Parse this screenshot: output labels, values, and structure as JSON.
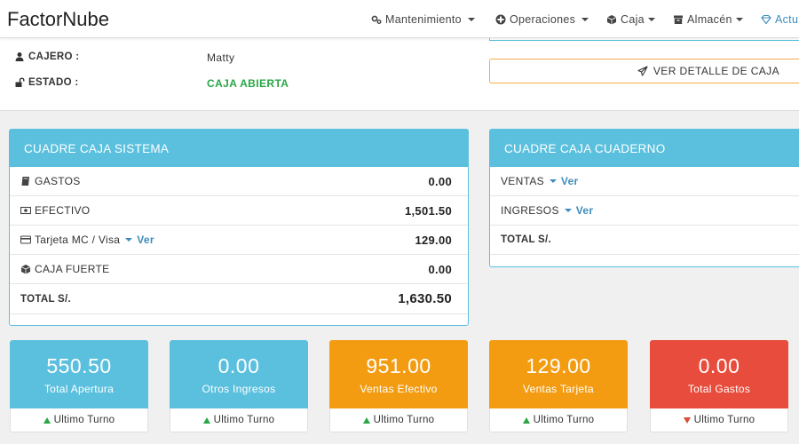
{
  "navbar": {
    "brand": "FactorNube",
    "items": [
      {
        "label": "Mantenimiento",
        "icon": "cogs-icon"
      },
      {
        "label": "Operaciones",
        "icon": "plus-circle-icon"
      },
      {
        "label": "Caja",
        "icon": "cube-icon"
      },
      {
        "label": "Almacén",
        "icon": "archive-icon"
      },
      {
        "label": "Actu",
        "icon": "diamond-icon"
      }
    ]
  },
  "info": {
    "cajero_label": "CAJERO :",
    "cajero_value": "Matty",
    "estado_label": "ESTADO :",
    "estado_value": "CAJA ABIERTA",
    "ver_detalle": "VER DETALLE DE CAJA"
  },
  "sistema": {
    "title": "CUADRE CAJA SISTEMA",
    "rows": [
      {
        "label": "GASTOS",
        "value": "0.00",
        "icon": "book-icon"
      },
      {
        "label": "EFECTIVO",
        "value": "1,501.50",
        "icon": "money-icon"
      },
      {
        "label": "Tarjeta MC / Visa",
        "link": "Ver",
        "value": "129.00",
        "icon": "credit-card-icon"
      },
      {
        "label": "CAJA FUERTE",
        "value": "0.00",
        "icon": "cube-icon"
      }
    ],
    "total_label": "TOTAL S/.",
    "total_value": "1,630.50"
  },
  "cuaderno": {
    "title": "CUADRE CAJA CUADERNO",
    "rows": [
      {
        "label": "VENTAS",
        "link": "Ver"
      },
      {
        "label": "INGRESOS",
        "link": "Ver"
      }
    ],
    "total_label": "TOTAL S/."
  },
  "stats": [
    {
      "value": "550.50",
      "label": "Total Apertura",
      "foot": "Ultimo Turno",
      "color": "#5bc0de",
      "trend": "up"
    },
    {
      "value": "0.00",
      "label": "Otros Ingresos",
      "foot": "Ultimo Turno",
      "color": "#5bc0de",
      "trend": "up"
    },
    {
      "value": "951.00",
      "label": "Ventas Efectivo",
      "foot": "Ultimo Turno",
      "color": "#f39c12",
      "trend": "up"
    },
    {
      "value": "129.00",
      "label": "Ventas Tarjeta",
      "foot": "Ultimo Turno",
      "color": "#f39c12",
      "trend": "up"
    },
    {
      "value": "0.00",
      "label": "Total Gastos",
      "foot": "Ultimo Turno",
      "color": "#e74c3c",
      "trend": "down"
    }
  ],
  "colors": {
    "info": "#5bc0de",
    "warning": "#f39c12",
    "danger": "#e74c3c",
    "success": "#28a745",
    "link": "#3c8dbc"
  }
}
